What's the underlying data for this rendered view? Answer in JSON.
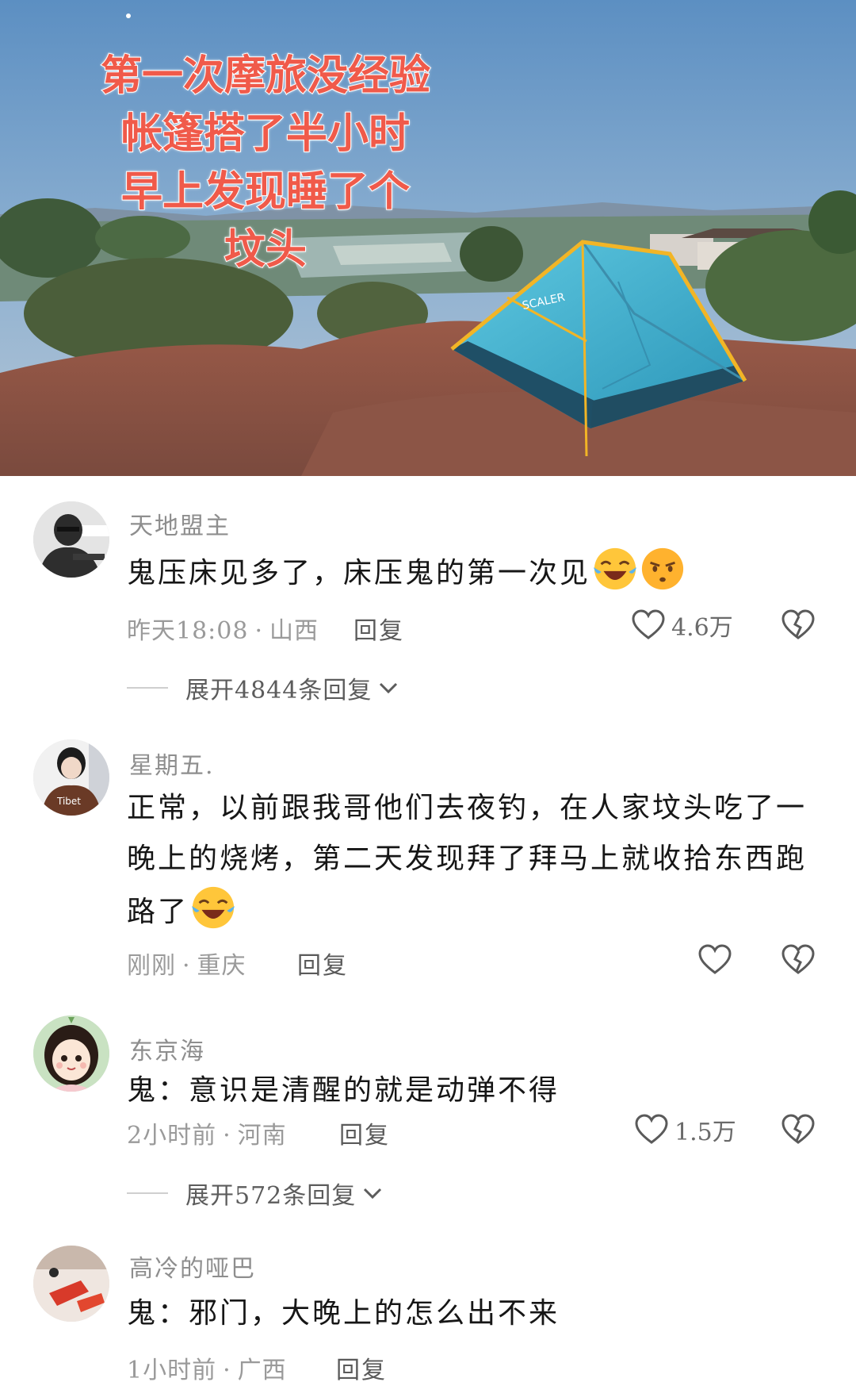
{
  "post": {
    "caption_lines": [
      "第一次摩旅没经验",
      "帐篷搭了半小时",
      "早上发现睡了个",
      "坟头"
    ],
    "tent_logo": "SCALER"
  },
  "comments": [
    {
      "username": "天地盟主",
      "text": "鬼压床见多了，床压鬼的第一次见",
      "emojis": [
        "laughing-crying-emoji",
        "smirk-emoji"
      ],
      "time": "昨天18:08",
      "location": "山西",
      "reply_label": "回复",
      "likes": "4.6万",
      "expand_label": "展开4844条回复"
    },
    {
      "username": "星期五.",
      "text": "正常，以前跟我哥他们去夜钓，在人家坟头吃了一晚上的烧烤，第二天发现拜了拜马上就收拾东西跑路了",
      "emojis": [
        "laughing-crying-emoji"
      ],
      "time": "刚刚",
      "location": "重庆",
      "reply_label": "回复",
      "likes": ""
    },
    {
      "username": "东京海",
      "text": "鬼：意识是清醒的就是动弹不得",
      "time": "2小时前",
      "location": "河南",
      "reply_label": "回复",
      "likes": "1.5万",
      "expand_label": "展开572条回复"
    },
    {
      "username": "高冷的哑巴",
      "text": "鬼：邪门，大晚上的怎么出不来",
      "time": "1小时前",
      "location": "广西",
      "reply_label": "回复"
    }
  ],
  "meta_separator": "·",
  "colors": {
    "caption": "#f05a4a",
    "meta": "#9a9a9a",
    "username": "#8e8e8e"
  }
}
